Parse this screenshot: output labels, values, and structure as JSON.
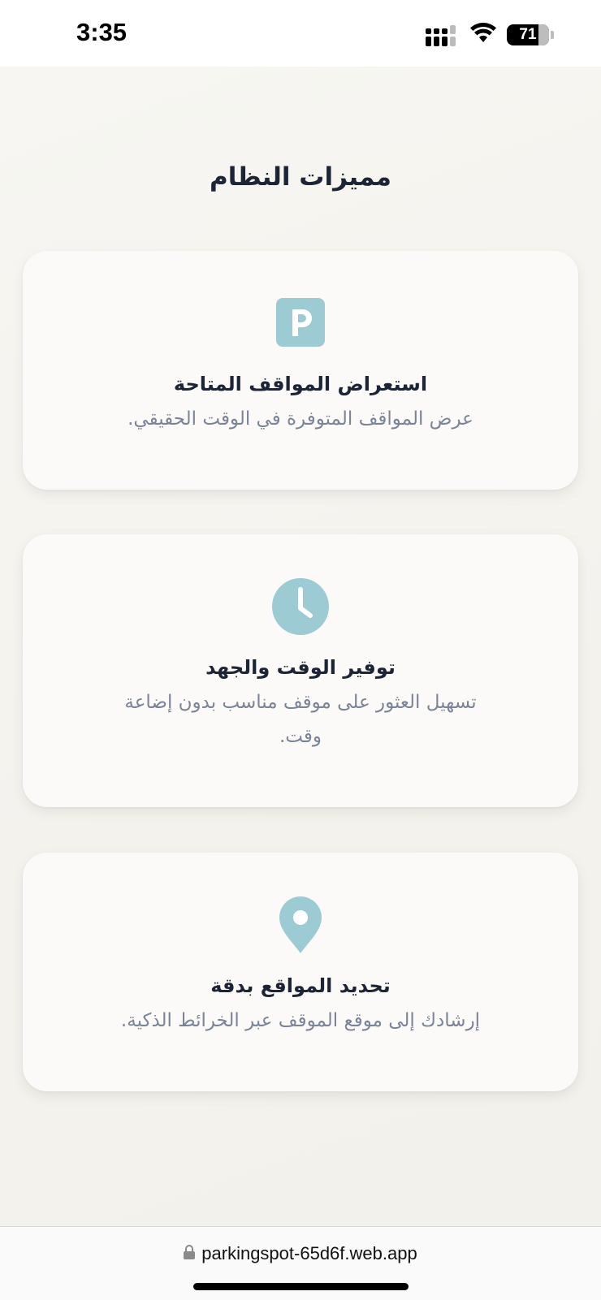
{
  "status": {
    "time": "3:35",
    "battery": "71",
    "icons": [
      "signal-icon",
      "wifi-icon",
      "battery-icon"
    ]
  },
  "page": {
    "title": "مميزات النظام"
  },
  "features": [
    {
      "icon": "parking-icon",
      "title": "استعراض المواقف المتاحة",
      "description": "عرض المواقف المتوفرة في الوقت الحقيقي."
    },
    {
      "icon": "clock-icon",
      "title": "توفير الوقت والجهد",
      "description": "تسهيل العثور على موقف مناسب بدون إضاعة وقت."
    },
    {
      "icon": "map-pin-icon",
      "title": "تحديد المواقع بدقة",
      "description": "إرشادك إلى موقع الموقف عبر الخرائط الذكية."
    }
  ],
  "browser": {
    "url": "parkingspot-65d6f.web.app",
    "lock_icon": "lock-icon"
  },
  "colors": {
    "accent": "#9ccbd3",
    "title_text": "#1c2436",
    "body_text": "#7b8497",
    "background": "#f5f3ee",
    "card": "#fbfaf8"
  }
}
